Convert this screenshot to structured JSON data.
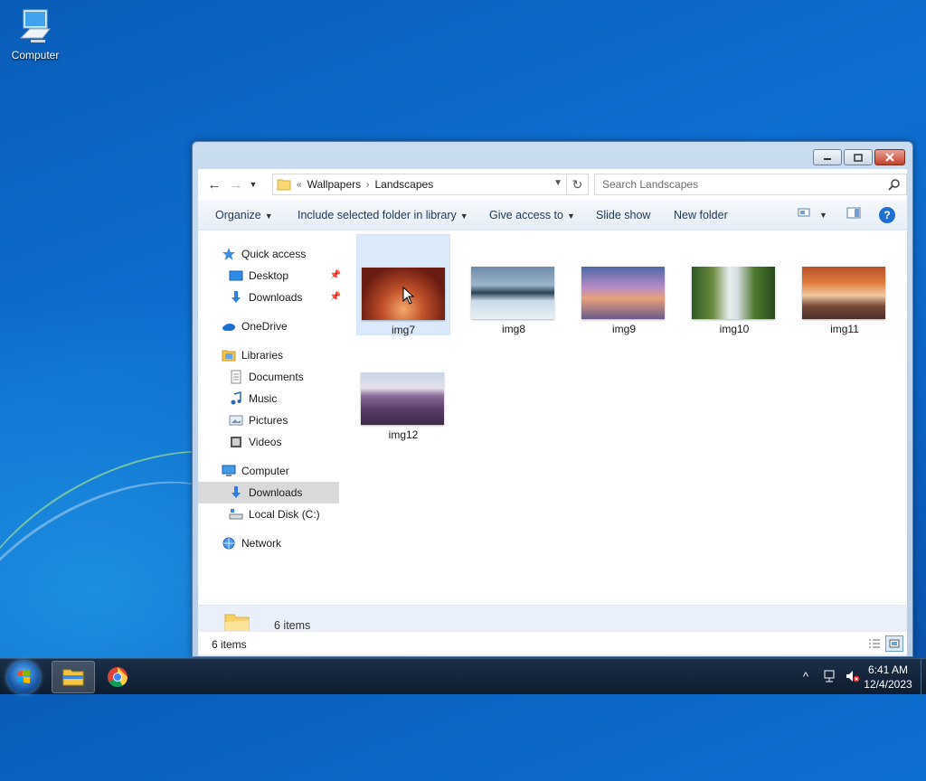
{
  "desktop": {
    "icon_label": "Computer"
  },
  "explorer": {
    "address": {
      "overflow": "«",
      "crumbs": [
        "Wallpapers",
        "Landscapes"
      ]
    },
    "search_placeholder": "Search Landscapes",
    "toolbar": {
      "organize": "Organize",
      "include": "Include selected folder in library",
      "share": "Give access to",
      "slideshow": "Slide show",
      "new_folder": "New folder",
      "help": "?"
    },
    "nav": {
      "quick_access": "Quick access",
      "desktop": "Desktop",
      "downloads": "Downloads",
      "onedrive": "OneDrive",
      "libraries": "Libraries",
      "documents": "Documents",
      "music": "Music",
      "pictures": "Pictures",
      "videos": "Videos",
      "computer": "Computer",
      "comp_downloads": "Downloads",
      "local_disk": "Local Disk (C:)",
      "network": "Network"
    },
    "files": [
      {
        "name": "img7",
        "selected": true
      },
      {
        "name": "img8"
      },
      {
        "name": "img9"
      },
      {
        "name": "img10"
      },
      {
        "name": "img11"
      },
      {
        "name": "img12"
      }
    ],
    "details_count": "6 items",
    "status_count": "6 items"
  },
  "taskbar": {
    "time": "6:41 AM",
    "date": "12/4/2023"
  }
}
